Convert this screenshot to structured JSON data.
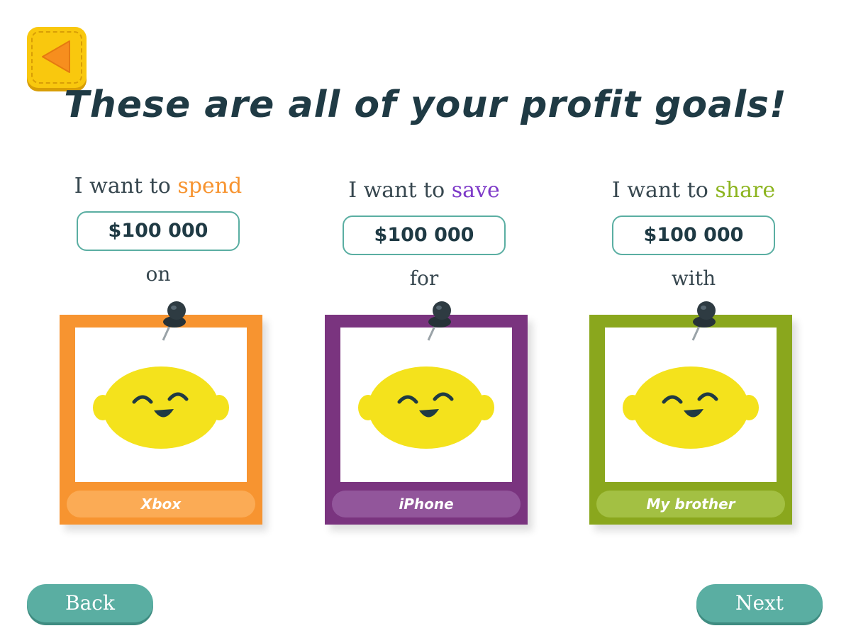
{
  "header": {
    "title": "These are all of your profit goals!",
    "back_icon": "triangle-left-icon"
  },
  "goals": [
    {
      "prompt_prefix": "I want to ",
      "keyword": "spend",
      "keyword_color": "#f79430",
      "amount": "$100 000",
      "connector": "on",
      "item_label": "Xbox",
      "card_color": "#f79430"
    },
    {
      "prompt_prefix": "I want to ",
      "keyword": "save",
      "keyword_color": "#7d39c8",
      "amount": "$100 000",
      "connector": "for",
      "item_label": "iPhone",
      "card_color": "#7a347f"
    },
    {
      "prompt_prefix": "I want to ",
      "keyword": "share",
      "keyword_color": "#8cb41e",
      "amount": "$100 000",
      "connector": "with",
      "item_label": "My brother",
      "card_color": "#8aa71d"
    }
  ],
  "footer": {
    "back_label": "Back",
    "next_label": "Next"
  },
  "icons": {
    "pin": "pushpin-icon",
    "lemon": "smiling-lemon-icon"
  },
  "colors": {
    "accent": "#5aaea2",
    "title": "#1f3a44"
  }
}
